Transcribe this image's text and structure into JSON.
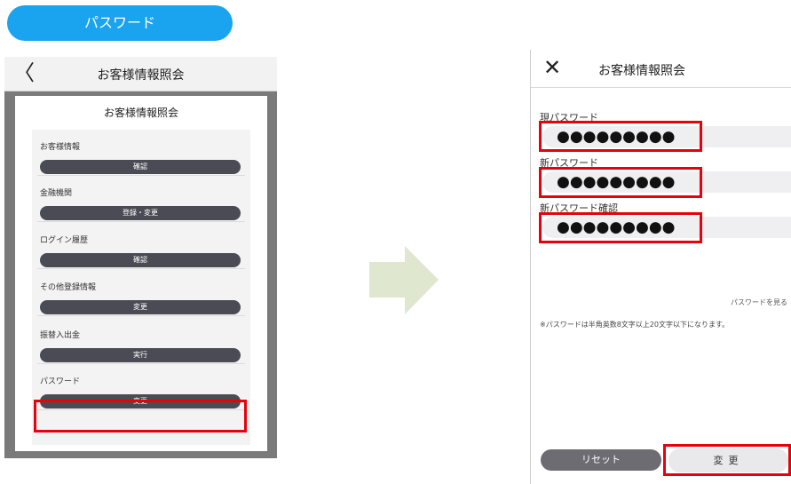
{
  "header": {
    "pill_label": "パスワード"
  },
  "left": {
    "back_icon": "chevron-left-icon",
    "title": "お客様情報照会",
    "panel_heading": "お客様情報照会",
    "sections": [
      {
        "label": "お客様情報",
        "button": "確認"
      },
      {
        "label": "金融機関",
        "button": "登録・変更"
      },
      {
        "label": "ログイン履歴",
        "button": "確認"
      },
      {
        "label": "その他登録情報",
        "button": "変更"
      },
      {
        "label": "振替入出金",
        "button": "実行"
      },
      {
        "label": "パスワード",
        "button": "変更"
      }
    ]
  },
  "right": {
    "close_icon": "close-icon",
    "title": "お客様情報照会",
    "fields": [
      {
        "label": "現パスワード",
        "value": "●●●●●●●●●"
      },
      {
        "label": "新パスワード",
        "value": "●●●●●●●●●"
      },
      {
        "label": "新パスワード確認",
        "value": "●●●●●●●●●"
      }
    ],
    "show_password": "パスワードを見る",
    "note": "※パスワードは半角英数8文字以上20文字以下になります。",
    "reset_label": "リセット",
    "change_label": "変更"
  },
  "colors": {
    "highlight": "#e8000b",
    "pill": "#1aa3ee",
    "arrow": "#dfe8cf",
    "button_dark": "#4b4b55"
  }
}
